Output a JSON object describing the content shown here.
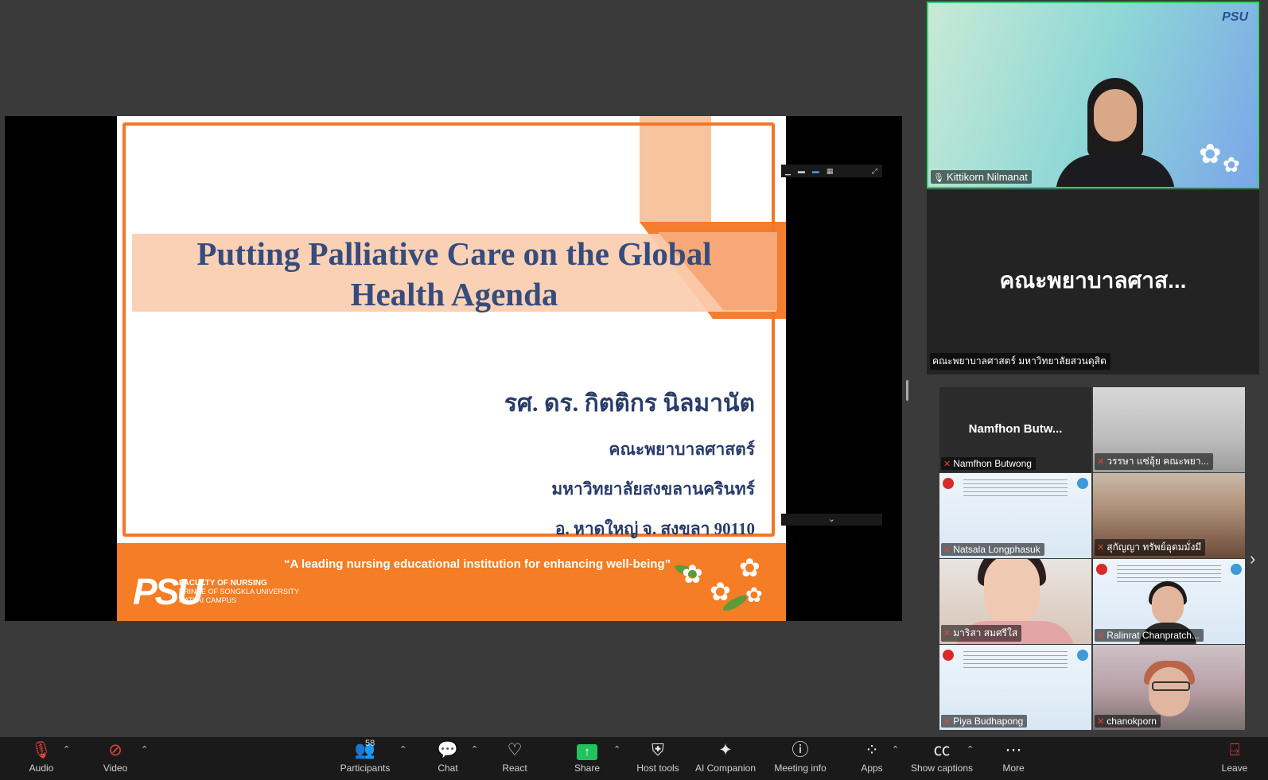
{
  "slide": {
    "title_line1": "Putting Palliative Care on the Global",
    "title_line2": "Health Agenda",
    "presenter_name": "รศ. ดร. กิตติกร นิลมานัต",
    "faculty": "คณะพยาบาลศาสตร์",
    "university": "มหาวิทยาลัยสงขลานครินทร์",
    "address": "อ. หาดใหญ่ จ. สงขลา 90110",
    "tagline": "“A leading nursing educational institution for enhancing well-being”",
    "logo_mark": "PSU",
    "logo_line1": "FACULTY OF NURSING",
    "logo_line2": "PRINCE OF SONGKLA UNIVERSITY",
    "logo_line3": "HATYAI CAMPUS",
    "accent_color": "#f47d25"
  },
  "speaker": {
    "name": "Kittikorn Nilmanat",
    "logo": "PSU"
  },
  "big_tile": {
    "center_name": "คณะพยาบาลศาส...",
    "label": "คณะพยาบาลศาสตร์ มหาวิทยาลัยสวนดุสิต"
  },
  "participants": [
    {
      "name": "Namfhon Butwong",
      "center_name": "Namfhon Butw..."
    },
    {
      "name": "วรรษา  แซ่อุ้ย คณะพยา..."
    },
    {
      "name": "Natsala Longphasuk"
    },
    {
      "name": "สุกัญญา  ทรัพย์อุดมมั่งมี"
    },
    {
      "name": "มาริสา สมศรีใส"
    },
    {
      "name": "Ralinrat Chanpratch..."
    },
    {
      "name": "Piya Budhapong"
    },
    {
      "name": "chanokporn"
    }
  ],
  "toolbar": {
    "audio": "Audio",
    "video": "Video",
    "participants": "Participants",
    "participants_count": "58",
    "chat": "Chat",
    "react": "React",
    "share": "Share",
    "host_tools": "Host tools",
    "ai_companion": "AI Companion",
    "meeting_info": "Meeting info",
    "apps": "Apps",
    "show_captions": "Show captions",
    "more": "More",
    "leave": "Leave"
  },
  "icons": {
    "audio": "microphone-muted-icon",
    "video": "camera-off-icon",
    "participants": "people-icon",
    "chat": "chat-bubble-icon",
    "react": "heart-icon",
    "share": "share-arrow-icon",
    "host_tools": "shield-icon",
    "ai_companion": "sparkle-icon",
    "meeting_info": "info-icon",
    "apps": "apps-icon",
    "show_captions": "cc-icon",
    "more": "more-icon",
    "leave": "leave-icon"
  }
}
